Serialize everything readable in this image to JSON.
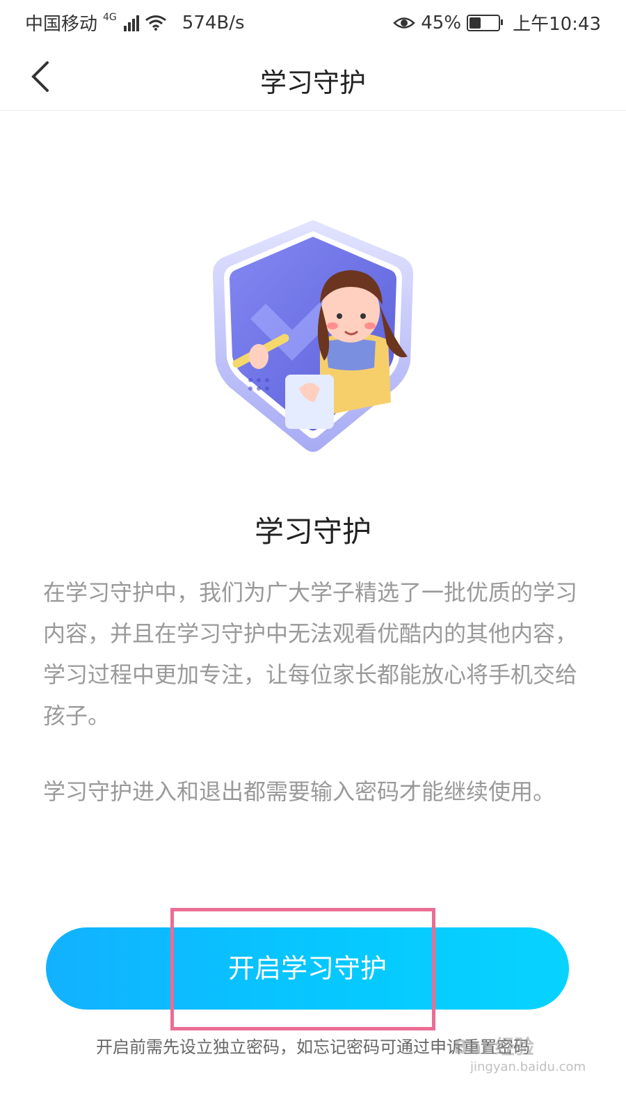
{
  "status_bar": {
    "carrier": "中国移动",
    "network": "4G",
    "speed": "574B/s",
    "battery_percent": "45%",
    "battery_level": 0.45,
    "time": "上午10:43",
    "icons": [
      "signal-icon",
      "wifi-icon",
      "eye-icon",
      "battery-icon"
    ]
  },
  "nav": {
    "title": "学习守护",
    "back_icon": "chevron-left-icon"
  },
  "main": {
    "illustration": "shield-girl-illustration",
    "title": "学习守护",
    "description_1": "在学习守护中，我们为广大学子精选了一批优质的学习内容，并且在学习守护中无法观看优酷内的其他内容，学习过程中更加专注，让每位家长都能放心将手机交给孩子。",
    "description_2": "学习守护进入和退出都需要输入密码才能继续使用。"
  },
  "actions": {
    "enable_label": "开启学习守护",
    "hint": "开启前需先设立独立密码，如忘记密码可通过申诉重置密码"
  },
  "watermark": {
    "text": "Bai 经验",
    "sub": "jingyan.baidu.com"
  },
  "colors": {
    "button_start": "#12b1ff",
    "button_end": "#07d3ff",
    "highlight": "#ea6d93",
    "shield": "#6f73ea"
  }
}
